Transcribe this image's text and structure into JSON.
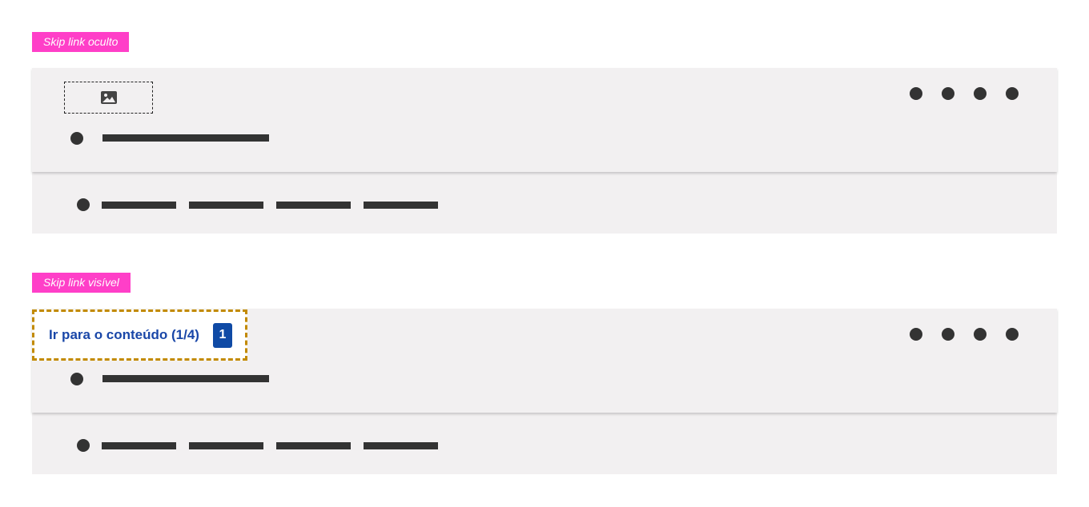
{
  "sections": {
    "hidden": {
      "tag_label": "Skip link oculto"
    },
    "visible": {
      "tag_label": "Skip link visível"
    }
  },
  "skip_link": {
    "label": "Ir para o conteúdo (1/4)",
    "badge": "1"
  },
  "icons": {
    "logo": "image-icon"
  },
  "colors": {
    "tag_background": "#ff3fc8",
    "header_background": "#f2f0f1",
    "skip_link_text": "#1a47a8",
    "skip_link_border": "#c28a00",
    "badge_background": "#0f4aa5"
  }
}
